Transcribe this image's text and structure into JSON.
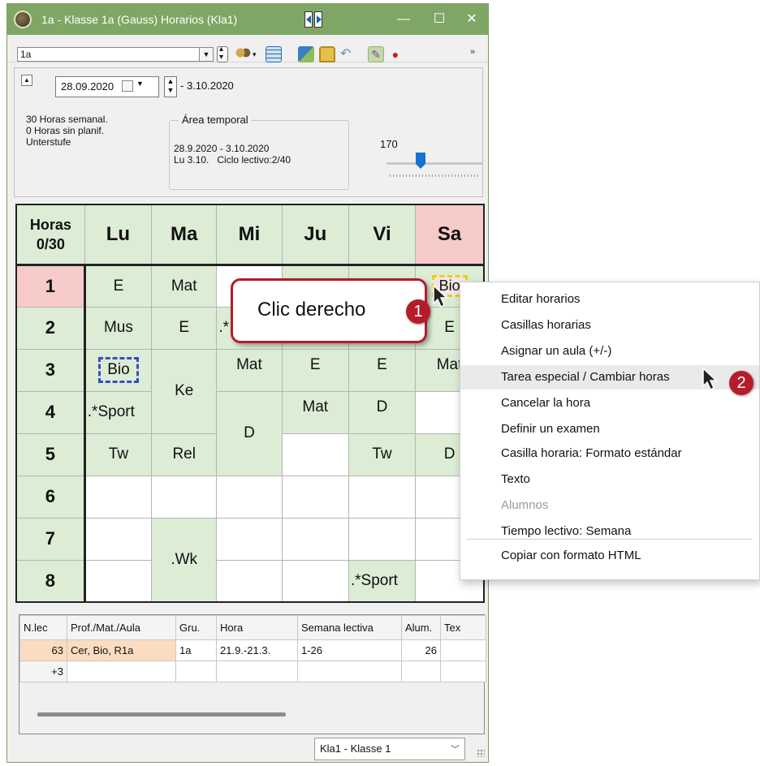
{
  "window": {
    "title": "1a - Klasse 1a (Gauss)  Horarios  (Kla1)",
    "controls": {
      "minimize": "—",
      "maximize": "☐",
      "close": "✕"
    }
  },
  "toolbar": {
    "class_value": "1a",
    "more": "»"
  },
  "header": {
    "date_start": "28.09.2020",
    "date_end": "- 3.10.2020",
    "hours_week": "30  Horas semanal.",
    "hours_unplanned": "0  Horas sin planif.",
    "group": "Unterstufe",
    "time_area_label": "Área temporal",
    "time_range": "28.9.2020 - 3.10.2020",
    "time_cycle": "Lu 3.10.   Ciclo lectivo:2/40",
    "slider_value": "170"
  },
  "timetable": {
    "corner_line1": "Horas",
    "corner_line2": "0/30",
    "days": [
      "Lu",
      "Ma",
      "Mi",
      "Ju",
      "Vi",
      "Sa"
    ],
    "periods": [
      "1",
      "2",
      "3",
      "4",
      "5",
      "6",
      "7",
      "8"
    ],
    "cells": {
      "p1_lu": "E",
      "p1_ma": "Mat",
      "p1_sa": "Bio",
      "p2_lu": "Mus",
      "p2_ma": "E",
      "p2_mi": ".*",
      "p2_sa": "E",
      "p3_lu": "Bio",
      "p34_ma": "Ke",
      "p3_mi": "Mat",
      "p3_ju": "E",
      "p3_vi": "E",
      "p3_sa": "Mat",
      "p4_lu": ".*Sport",
      "p45_mi": "D",
      "p4_ju": "Mat",
      "p4_vi": "D",
      "p5_lu": "Tw",
      "p5_ma": "Rel",
      "p5_vi": "Tw",
      "p5_sa": "D",
      "p78_ma": ".Wk",
      "p8_vi": ".*Sport"
    }
  },
  "lessons": {
    "headers": [
      "N.lec",
      "Prof./Mat./Aula",
      "Gru.",
      "Hora",
      "Semana lectiva",
      "Alum.",
      "Tex"
    ],
    "rows": [
      [
        "63",
        "Cer, Bio, R1a",
        "1a",
        "21.9.-21.3.",
        "1-26",
        "26",
        ""
      ],
      [
        "+3",
        "",
        "",
        "",
        "",
        "",
        ""
      ]
    ]
  },
  "footer": {
    "class_dropdown": "Kla1 - Klasse 1"
  },
  "callout": {
    "text": "Clic derecho",
    "step1": "1",
    "step2": "2"
  },
  "context_menu": {
    "items": [
      "Editar horarios",
      "Casillas horarias",
      "Asignar un aula (+/-)",
      "Tarea especial / Cambiar horas",
      "Cancelar la hora",
      "Definir un examen",
      "Casilla horaria: Formato estándar",
      "Texto",
      "Alumnos",
      "Tiempo lectivo: Semana",
      "Copiar con formato HTML"
    ]
  },
  "colors": {
    "titlebar": "#7fa665",
    "lesson_green": "#dcecd5",
    "saturday_pink": "#f7caca",
    "accent_red": "#b51c2a"
  }
}
